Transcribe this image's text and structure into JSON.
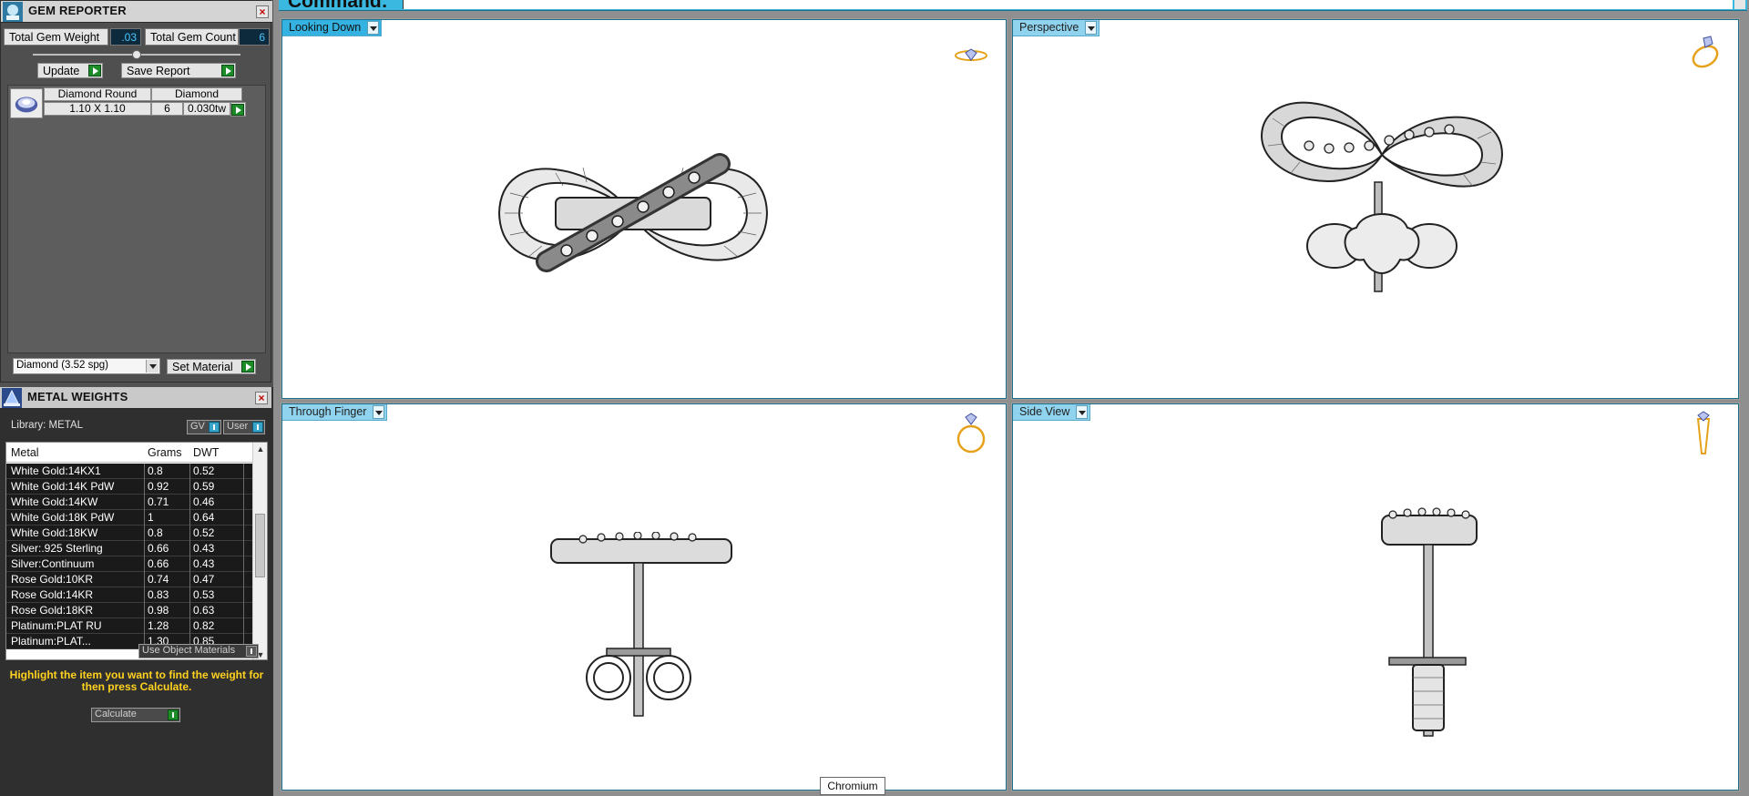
{
  "gem_reporter": {
    "title": "GEM REPORTER",
    "total_gem_weight_label": "Total Gem Weight",
    "total_gem_weight_value": ".03",
    "total_gem_count_label": "Total Gem Count",
    "total_gem_count_value": "6",
    "update_label": "Update",
    "save_report_label": "Save Report",
    "gem": {
      "shape": "Diamond Round",
      "size": "1.10 X 1.10",
      "material": "Diamond",
      "count": "6",
      "weight": "0.030tw"
    },
    "material_select": "Diamond    (3.52 spg)",
    "set_material_label": "Set Material"
  },
  "metal_weights": {
    "title": "METAL WEIGHTS",
    "library_label": "Library: METAL",
    "gv_label": "GV",
    "user_label": "User",
    "columns": [
      "Metal",
      "Grams",
      "DWT"
    ],
    "rows": [
      [
        "White Gold:14KX1",
        "0.8",
        "0.52"
      ],
      [
        "White Gold:14K PdW",
        "0.92",
        "0.59"
      ],
      [
        "White Gold:14KW",
        "0.71",
        "0.46"
      ],
      [
        "White Gold:18K PdW",
        "1",
        "0.64"
      ],
      [
        "White Gold:18KW",
        "0.8",
        "0.52"
      ],
      [
        "Silver:.925 Sterling",
        "0.66",
        "0.43"
      ],
      [
        "Silver:Continuum",
        "0.66",
        "0.43"
      ],
      [
        "Rose Gold:10KR",
        "0.74",
        "0.47"
      ],
      [
        "Rose Gold:14KR",
        "0.83",
        "0.53"
      ],
      [
        "Rose Gold:18KR",
        "0.98",
        "0.63"
      ],
      [
        "Platinum:PLAT RU",
        "1.28",
        "0.82"
      ],
      [
        "Platinum:PLAT...",
        "1.30",
        "0.85"
      ]
    ],
    "use_object_materials_label": "Use Object Materials",
    "hint": "Highlight the item you want to find the weight for then press Calculate.",
    "calculate_label": "Calculate"
  },
  "command": {
    "label": "Command:"
  },
  "viewports": {
    "top_left": "Looking Down",
    "top_right": "Perspective",
    "bottom_left": "Through Finger",
    "bottom_right": "Side View"
  },
  "status": {
    "material": "Chromium"
  },
  "colors": {
    "viewport_tab": "#8fd3ee",
    "active_tab": "#34b3e2",
    "command_bar": "#3ab8e0",
    "hint_text": "#ffd21f",
    "go_button": "#1d8c28"
  }
}
